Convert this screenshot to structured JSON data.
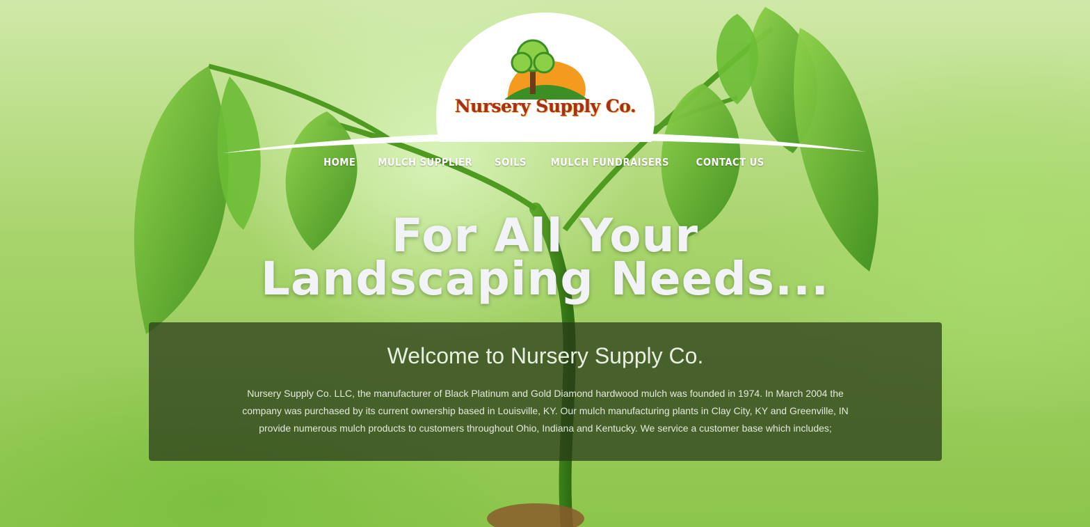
{
  "brand": {
    "name": "Nursery Supply Co."
  },
  "nav": {
    "items": [
      {
        "label": "HOME"
      },
      {
        "label": "MULCH SUPPLIER"
      },
      {
        "label": "SOILS"
      },
      {
        "label": "MULCH FUNDRAISERS"
      },
      {
        "label": "CONTACT US"
      }
    ]
  },
  "hero": {
    "headline_line1": "For All Your",
    "headline_line2": "Landscaping Needs..."
  },
  "welcome": {
    "title": "Welcome to Nursery Supply Co.",
    "body": "Nursery Supply Co. LLC, the manufacturer of Black Platinum and Gold Diamond hardwood mulch was founded in 1974. In March 2004 the company was purchased by its current ownership based in Louisville, KY. Our mulch manufacturing plants in Clay City, KY and Greenville, IN provide numerous mulch products to customers throughout Ohio, Indiana and Kentucky. We service a customer base which includes;"
  },
  "colors": {
    "logo_text": "#a3301a",
    "logo_sun": "#f39a1f",
    "panel_bg": "#28371a",
    "leaf": "#5aa82a"
  },
  "icons": {
    "logo": "tree-sun-logo-icon"
  }
}
